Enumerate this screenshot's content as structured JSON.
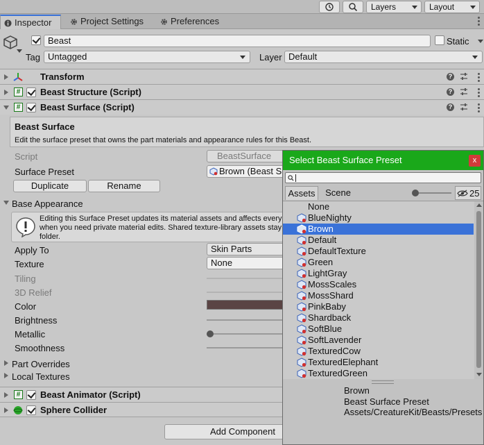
{
  "toolbar": {
    "history_icon": "history-icon",
    "search_icon": "search-icon",
    "layers_label": "Layers",
    "layout_label": "Layout"
  },
  "tabs": [
    {
      "label": "Inspector",
      "icon": "info-icon"
    },
    {
      "label": "Project Settings",
      "icon": "gear-icon"
    },
    {
      "label": "Preferences",
      "icon": "gear-icon"
    }
  ],
  "object": {
    "name": "Beast",
    "static_label": "Static",
    "tag_label": "Tag",
    "tag_value": "Untagged",
    "layer_label": "Layer",
    "layer_value": "Default"
  },
  "components": {
    "transform": "Transform",
    "structure": "Beast Structure (Script)",
    "surface": "Beast Surface (Script)",
    "animator": "Beast Animator (Script)",
    "collider": "Sphere Collider"
  },
  "surface": {
    "header_title": "Beast Surface",
    "header_desc": "Edit the surface preset that owns the part materials and appearance rules for this Beast.",
    "script_label": "Script",
    "script_value": "BeastSurface",
    "preset_label": "Surface Preset",
    "preset_value": "Brown (Beast Surface Preset)",
    "duplicate_label": "Duplicate",
    "rename_label": "Rename"
  },
  "appearance": {
    "title": "Base Appearance",
    "warning_line1": "Editing this Surface Preset updates its material assets and affects every Beast using it. Duplicate it first",
    "warning_line2": "when you need private material edits. Shared texture-library assets stay",
    "warning_line3": "folder.",
    "apply_to_label": "Apply To",
    "apply_to_value": "Skin Parts",
    "texture_label": "Texture",
    "texture_value": "None",
    "tiling_label": "Tiling",
    "relief_label": "3D Relief",
    "color_label": "Color",
    "color_value": "#5a4444",
    "brightness_label": "Brightness",
    "metallic_label": "Metallic",
    "smoothness_label": "Smoothness"
  },
  "foldouts": {
    "part_overrides": "Part Overrides",
    "local_textures": "Local Textures"
  },
  "add_component_label": "Add Component",
  "popup": {
    "title": "Select Beast Surface Preset",
    "close_label": "x",
    "search_placeholder": "",
    "tab_assets": "Assets",
    "tab_scene": "Scene",
    "hidden_count": "25",
    "items": [
      "None",
      "BlueNighty",
      "Brown",
      "Default",
      "DefaultTexture",
      "Green",
      "LightGray",
      "MossScales",
      "MossShard",
      "PinkBaby",
      "Shardback",
      "SoftBlue",
      "SoftLavender",
      "TexturedCow",
      "TexturedElephant",
      "TexturedGreen"
    ],
    "selected_index": 2,
    "info_name": "Brown",
    "info_type": "Beast Surface Preset",
    "info_path": "Assets/CreatureKit/Beasts/Presets"
  },
  "colors": {
    "accent": "#3a72d8",
    "popup_header": "#1aa81a",
    "close": "#d23a3a"
  }
}
